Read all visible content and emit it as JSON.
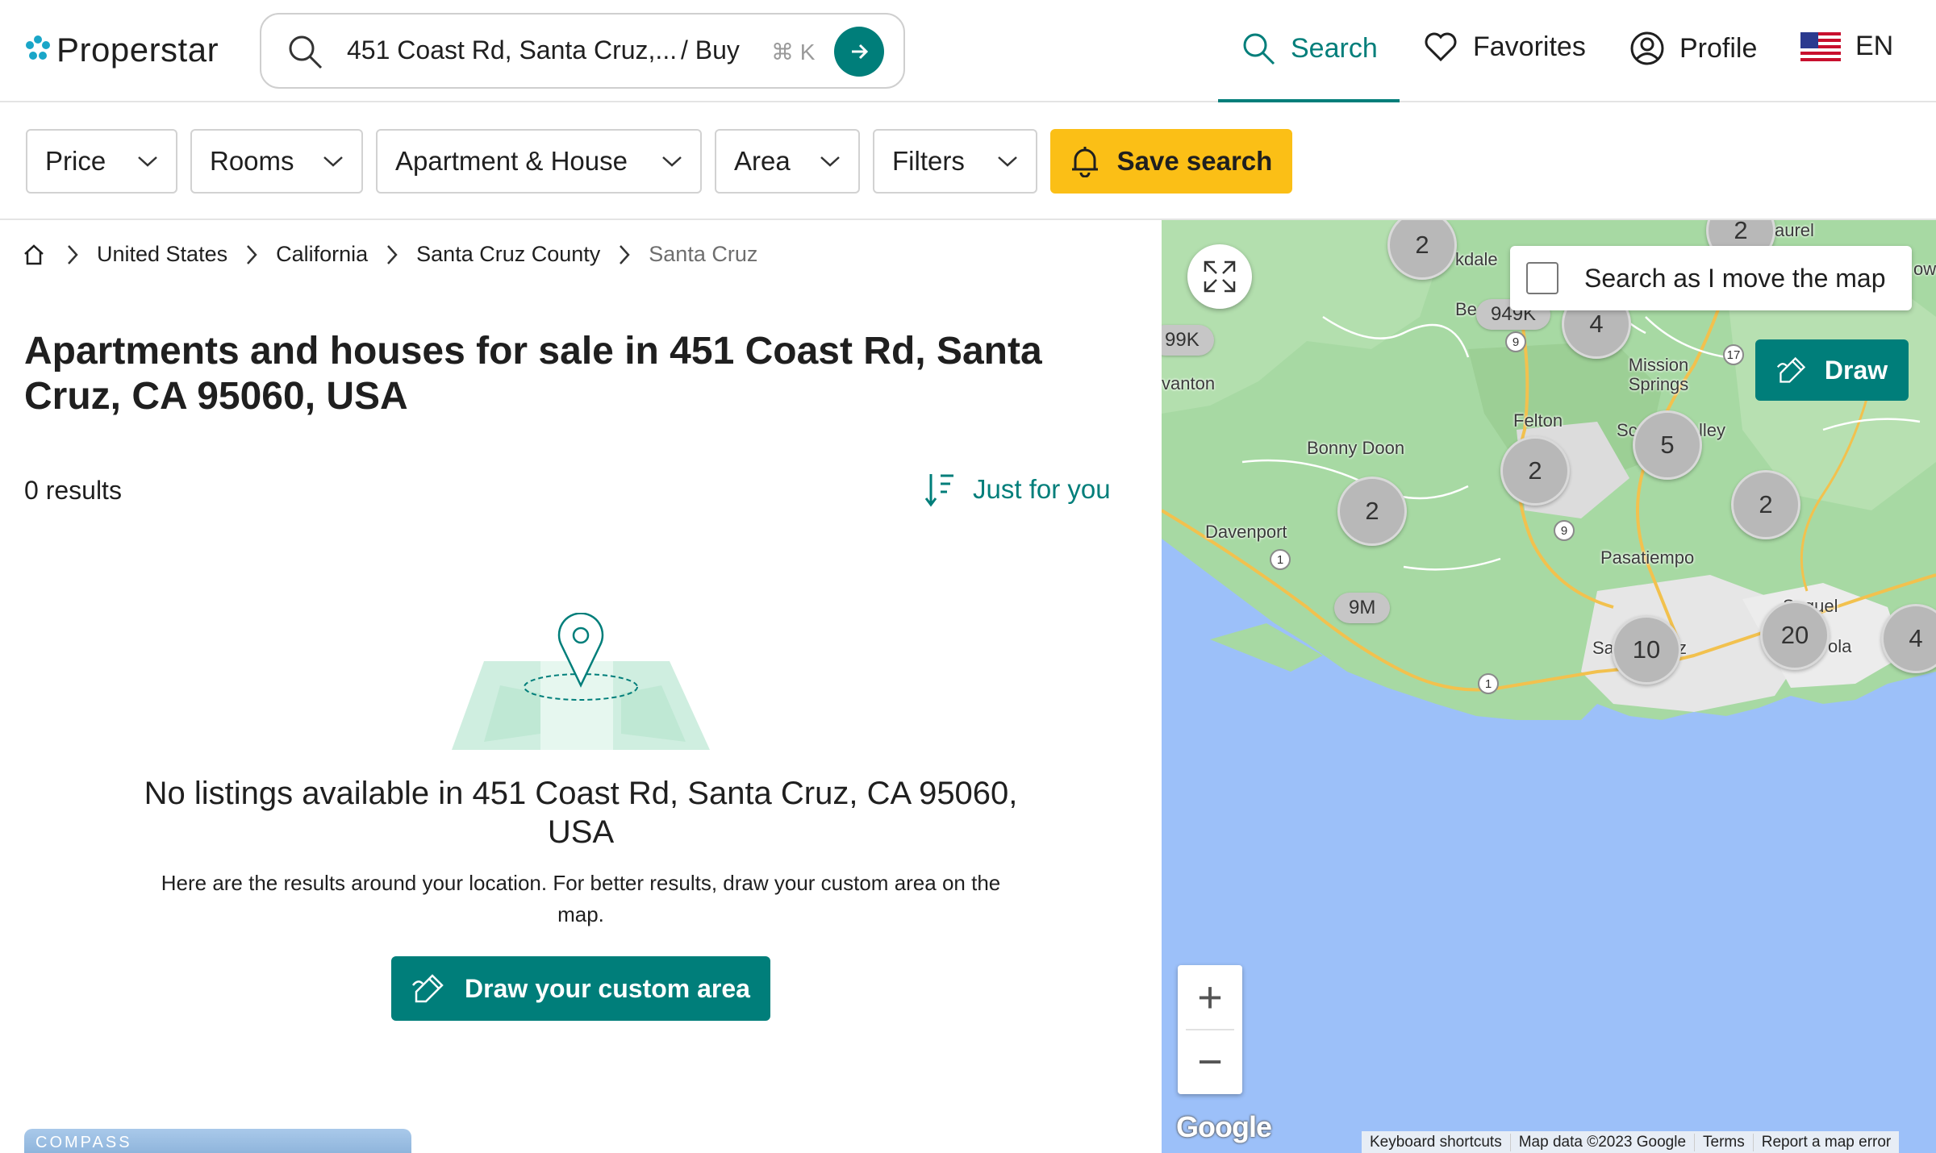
{
  "header": {
    "logo_text": "Properstar",
    "search_text": "451 Coast Rd, Santa Cruz,...",
    "search_mode": "/ Buy",
    "search_shortcut": "⌘ K",
    "nav": {
      "search": "Search",
      "favorites": "Favorites",
      "profile": "Profile",
      "language": "EN"
    }
  },
  "filters": {
    "price": "Price",
    "rooms": "Rooms",
    "type": "Apartment & House",
    "area": "Area",
    "more": "Filters",
    "save_search": "Save search"
  },
  "breadcrumb": [
    "United States",
    "California",
    "Santa Cruz County",
    "Santa Cruz"
  ],
  "main": {
    "title": "Apartments and houses for sale in 451 Coast Rd, Santa Cruz, CA 95060, USA",
    "results_count": "0 results",
    "sort_label": "Just for you",
    "empty_title": "No listings available in 451 Coast Rd, Santa Cruz, CA 95060, USA",
    "empty_sub": "Here are the results around your location. For better results, draw your custom area on the map.",
    "draw_button": "Draw your custom area",
    "thumb_brand": "COMPASS"
  },
  "map": {
    "search_as_move": "Search as I move the map",
    "draw_label": "Draw",
    "google": "Google",
    "attribution": [
      "Keyboard shortcuts",
      "Map data ©2023 Google",
      "Terms",
      "Report a map error"
    ],
    "clusters": [
      {
        "label": "2"
      },
      {
        "label": "2"
      },
      {
        "label": "4"
      },
      {
        "label": "5"
      },
      {
        "label": "2"
      },
      {
        "label": "2"
      },
      {
        "label": "2"
      },
      {
        "label": "10"
      },
      {
        "label": "20"
      },
      {
        "label": "4"
      }
    ],
    "price_tags": [
      "99K",
      "949K",
      "9M"
    ],
    "places": [
      "aurel",
      "kdale",
      "ows",
      "Be",
      "Mission Springs",
      "vanton",
      "Felton",
      "Bonny Doon",
      "Sc",
      "lley",
      "Davenport",
      "Pasatiempo",
      "Soquel",
      "Sa",
      "z",
      "ola"
    ],
    "routes": [
      "9",
      "17",
      "9",
      "1",
      "1"
    ]
  },
  "colors": {
    "accent": "#007e7a",
    "save": "#fbbf16",
    "water": "#9cc0f9",
    "land": "#a8d8a0"
  }
}
